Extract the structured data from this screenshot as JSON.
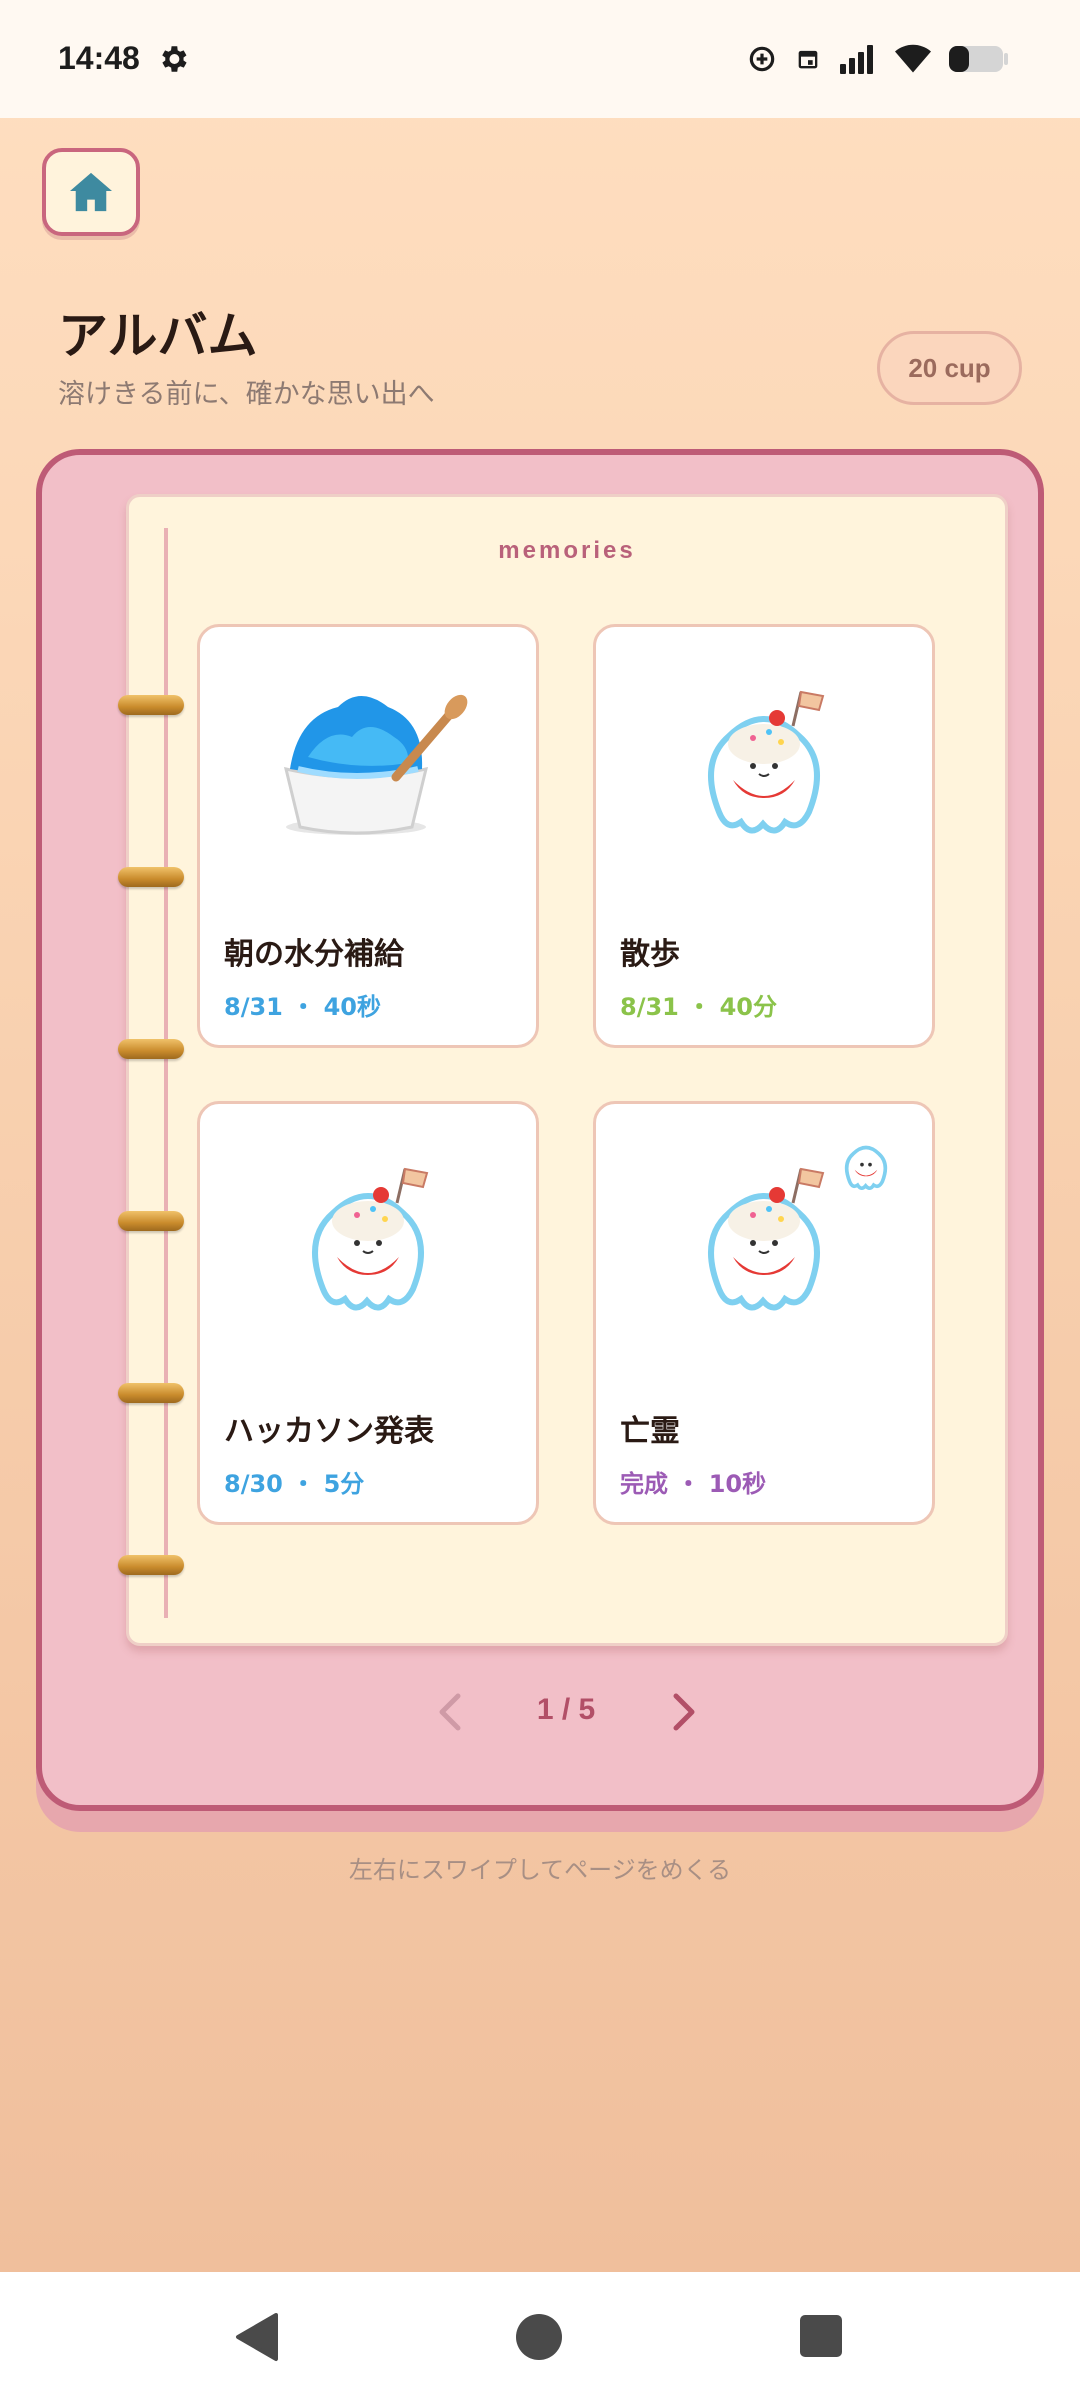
{
  "status_bar": {
    "time": "14:48"
  },
  "header": {
    "home_button_icon": "home-icon",
    "title": "アルバム",
    "subtitle": "溶けきる前に、確かな思い出へ",
    "cup_count": "20 cup"
  },
  "album": {
    "page_label": "memories",
    "cards": [
      {
        "title": "朝の水分補給",
        "meta": "8/31 ・ 40秒",
        "color": "#3ea3e0",
        "image": "blue-shaved-ice-icon"
      },
      {
        "title": "散歩",
        "meta": "8/31 ・ 40分",
        "color": "#8bc34a",
        "image": "ice-cream-ghost-icon"
      },
      {
        "title": "ハッカソン発表",
        "meta": "8/30 ・ 5分",
        "color": "#3ea3e0",
        "image": "ice-cream-ghost-icon"
      },
      {
        "title": "亡霊",
        "meta": "完成 ・ 10秒",
        "color": "#9c5bb5",
        "image": "ice-cream-ghost-icon"
      }
    ],
    "pager": "1 / 5",
    "swipe_hint": "左右にスワイプしてページをめくる"
  },
  "colors": {
    "accent": "#be5b76",
    "page_bg": "#fff4dc",
    "album_bg": "#f2bfc8"
  }
}
